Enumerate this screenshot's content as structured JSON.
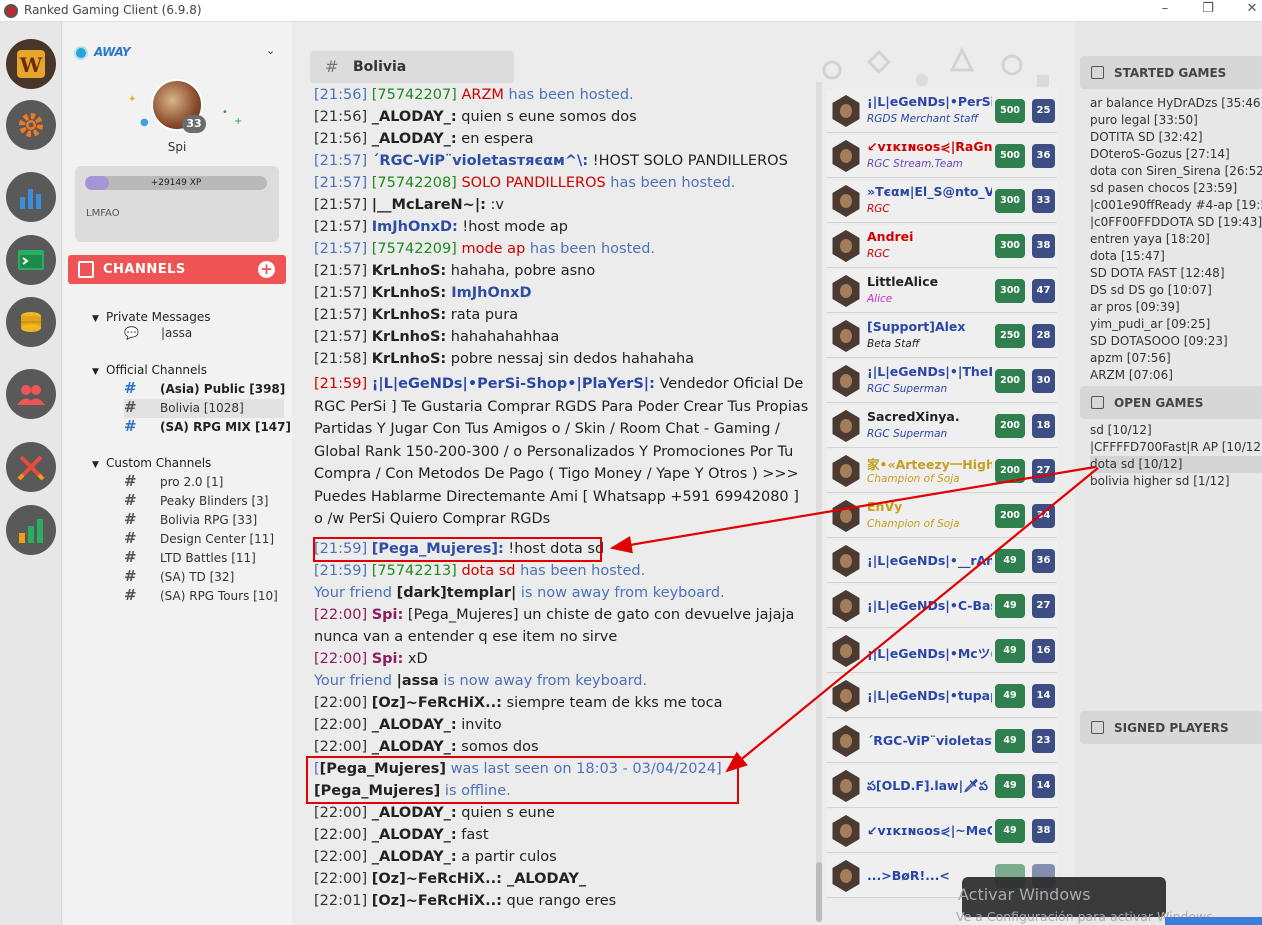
{
  "window": {
    "title": "Ranked Gaming Client (6.9.8)"
  },
  "user": {
    "status": "AWAY",
    "name": "Spi",
    "level": "33",
    "xp": "+29149 XP",
    "xp_fraction": 0.13,
    "motd": "LMFAO"
  },
  "channels": {
    "header": "CHANNELS",
    "private": {
      "label": "Private Messages",
      "items": [
        "|assa"
      ]
    },
    "official": {
      "label": "Official Channels",
      "items": [
        "(Asia) Public [398]",
        "Bolivia [1028]",
        "(SA) RPG MIX [147]"
      ]
    },
    "custom": {
      "label": "Custom Channels",
      "items": [
        "pro 2.0 [1]",
        "Peaky Blinders [3]",
        "Bolivia RPG [33]",
        "Design Center [11]",
        "LTD Battles [11]",
        "(SA) TD [32]",
        "(SA) RPG Tours [10]"
      ]
    }
  },
  "chat": {
    "channel": "Bolivia",
    "lines": [
      {
        "t": "[21:56]",
        "a": "[75742207]",
        "b": " ARZM",
        "c": " has been hosted."
      },
      {
        "t": "[21:56]",
        "u": "_ALODAY_:",
        "x": " quien s eune somos dos"
      },
      {
        "t": "[21:56]",
        "u": "_ALODAY_:",
        "x": " en espera"
      },
      {
        "t": "[21:57]",
        "u": " ´RGC-ViP¨violetaѕтяєαм^\\:",
        "x": " !HOST SOLO PANDILLEROS"
      },
      {
        "t": "[21:57]",
        "a": "[75742208]",
        "b": " SOLO PANDILLEROS",
        "c": " has been hosted."
      },
      {
        "t": "[21:57]",
        "u": "|__McLareN~|:",
        "x": " :v"
      },
      {
        "t": "[21:57]",
        "u": "ImJhOnxD:",
        "x": " !host mode ap"
      },
      {
        "t": "[21:57]",
        "a": "[75742209]",
        "b": " mode ap",
        "c": " has been hosted."
      },
      {
        "t": "[21:57]",
        "u": "KrLnhoS:",
        "x": " hahaha, pobre asno"
      },
      {
        "t": "[21:57]",
        "u": "KrLnhoS:",
        "x": " ImJhOnxD"
      },
      {
        "t": "[21:57]",
        "u": "KrLnhoS:",
        "x": " rata pura"
      },
      {
        "t": "[21:57]",
        "u": "KrLnhoS:",
        "x": " hahahahahhaa"
      },
      {
        "t": "[21:58]",
        "u": "KrLnhoS:",
        "x": " pobre nessaj sin dedos hahahaha"
      }
    ],
    "promo": {
      "t": "[21:59]",
      "u": "¡|L|eGeNDs|•PerSi-Shop•|PlaYerS|:",
      "text": "Vendedor Oficial De RGC PerSi ] Te Gustaria Comprar RGDS Para Poder Crear Tus Propias Partidas Y Jugar Con Tus Amigos o / Skin / Room Chat - Gaming / Global Rank 150-200-300 / o Personalizados Y Promociones Por Tu Compra / Con Metodos De Pago ( Tigo Money / Yape Y Otros ) >>> Puedes Hablarme Directemante Ami [ Whatsapp +591 69942080 ] o /w PerSi Quiero Comprar RGDs"
    },
    "lines2": [
      {
        "t": "[21:59]",
        "u": "[Pega_Mujeres]:",
        "x": " !host dota sd"
      },
      {
        "t": "[21:59]",
        "a": "[75742213]",
        "b": " dota sd",
        "c": " has been hosted."
      },
      {
        "s1": "Your friend ",
        "u": "[dark]templar|",
        "s2": " is now away from keyboard."
      },
      {
        "t": "[22:00]",
        "u": "Spi:",
        "x": " [Pega_Mujeres] un chiste de gato con devuelve jajaja"
      },
      {
        "x": "nunca van a entender q ese item no sirve"
      },
      {
        "t": "[22:00]",
        "u": "Spi:",
        "x": " xD"
      },
      {
        "s1": "Your friend ",
        "u": "|assa",
        "s2": " is now away from keyboard."
      },
      {
        "t": "[22:00]",
        "u": "[Oz]~FeRcHiX..:",
        "x": " siempre team de kks me toca"
      },
      {
        "t": "[22:00]",
        "u": "_ALODAY_:",
        "x": " invito"
      },
      {
        "t": "[22:00]",
        "u": "_ALODAY_:",
        "x": " somos dos"
      },
      {
        "u": "[Pega_Mujeres]",
        "s2": " was last seen on 18:03 - 03/04/2024]",
        "pre": "["
      },
      {
        "u": "[Pega_Mujeres]",
        "s2": " is offline."
      },
      {
        "t": "[22:00]",
        "u": "_ALODAY_:",
        "x": " quien s eune"
      },
      {
        "t": "[22:00]",
        "u": "_ALODAY_:",
        "x": " fast"
      },
      {
        "t": "[22:00]",
        "u": "_ALODAY_:",
        "x": " a partir culos"
      },
      {
        "t": "[22:00]",
        "u": "[Oz]~FeRcHiX..:",
        "x": " _ALODAY_"
      },
      {
        "t": "[22:01]",
        "u": "[Oz]~FeRcHiX..:",
        "x": " que rango eres"
      }
    ]
  },
  "players": [
    {
      "name": "¡|L|eGeNDs|•PerSi-",
      "tag": "RGDS Merchant Staff",
      "r1": "500",
      "r2": "25"
    },
    {
      "name": "↙ᴠɪᴋɪɴɢᴏѕ⋞|RaGna",
      "tag": "RGC Stream.Team",
      "r1": "500",
      "r2": "36"
    },
    {
      "name": "»Tєαм|El_S@nto_V@",
      "tag": "RGC",
      "r1": "300",
      "r2": "33"
    },
    {
      "name": "Andrei",
      "tag": "RGC",
      "r1": "300",
      "r2": "38"
    },
    {
      "name": "LittleAlice",
      "tag": "Alice",
      "r1": "300",
      "r2": "47"
    },
    {
      "name": "[Support]Alex",
      "tag": "Beta Staff",
      "r1": "250",
      "r2": "28"
    },
    {
      "name": "¡|L|eGeNDs|•|TheE",
      "tag": "RGC Superman",
      "r1": "200",
      "r2": "30"
    },
    {
      "name": "SacredXinya.",
      "tag": "RGC Superman",
      "r1": "200",
      "r2": "18"
    },
    {
      "name": "家•«Arteezy一HighS",
      "tag": "Champion of Soja",
      "r1": "200",
      "r2": "27"
    },
    {
      "name": "EnVy",
      "tag": "Champion of Soja",
      "r1": "200",
      "r2": "34"
    },
    {
      "name": "¡|L|eGeNDs|•__rAn",
      "tag": "",
      "r1": "49",
      "r2": "36"
    },
    {
      "name": "¡|L|eGeNDs|•C-Bas",
      "tag": "",
      "r1": "49",
      "r2": "27"
    },
    {
      "name": "¡|L|eGeNDs|•Mcツ(",
      "tag": "",
      "r1": "49",
      "r2": "16"
    },
    {
      "name": "¡|L|eGeNDs|•tupap",
      "tag": "",
      "r1": "49",
      "r2": "14"
    },
    {
      "name": "´RGC-ViP¨violetaѕтяє",
      "tag": "",
      "r1": "49",
      "r2": "23"
    },
    {
      "name": "ప[OLD.F].law|🗡ప",
      "tag": "",
      "r1": "49",
      "r2": "14"
    },
    {
      "name": "↙ᴠɪᴋɪɴɢᴏѕ⋞|~MeG@",
      "tag": "",
      "r1": "49",
      "r2": "38"
    },
    {
      "name": "...>BøR!...<",
      "tag": "",
      "r1": "",
      "r2": ""
    }
  ],
  "started_games": {
    "label": "STARTED GAMES",
    "items": [
      "ar balance HyDrADzs [35:46]",
      "puro legal [33:50]",
      "DOTITA SD [32:42]",
      "DOteroS-Gozus [27:14]",
      "dota con Siren_Sirena [26:52]",
      "sd pasen chocos [23:59]",
      "|c001e90ffReady #4-ap [19:5",
      "|c0FF00FFDDOTA SD [19:43]",
      "entren yaya [18:20]",
      "dota [15:47]",
      "SD DOTA FAST [12:48]",
      "DS sd DS go [10:07]",
      "ar pros [09:39]",
      "yim_pudi_ar [09:25]",
      "SD DOTASOOO [09:23]",
      "apzm [07:56]",
      "ARZM [07:06]"
    ]
  },
  "open_games": {
    "label": "OPEN GAMES",
    "items": [
      "sd [10/12]",
      "|CFFFFD700Fast|R AP [10/12",
      "dota sd [10/12]",
      "bolivia higher sd [1/12]"
    ]
  },
  "signed_players": {
    "label": "SIGNED PLAYERS"
  },
  "watermark": {
    "line1": "Activar Windows",
    "line2": "Ve a Configuración para activar Windows."
  }
}
